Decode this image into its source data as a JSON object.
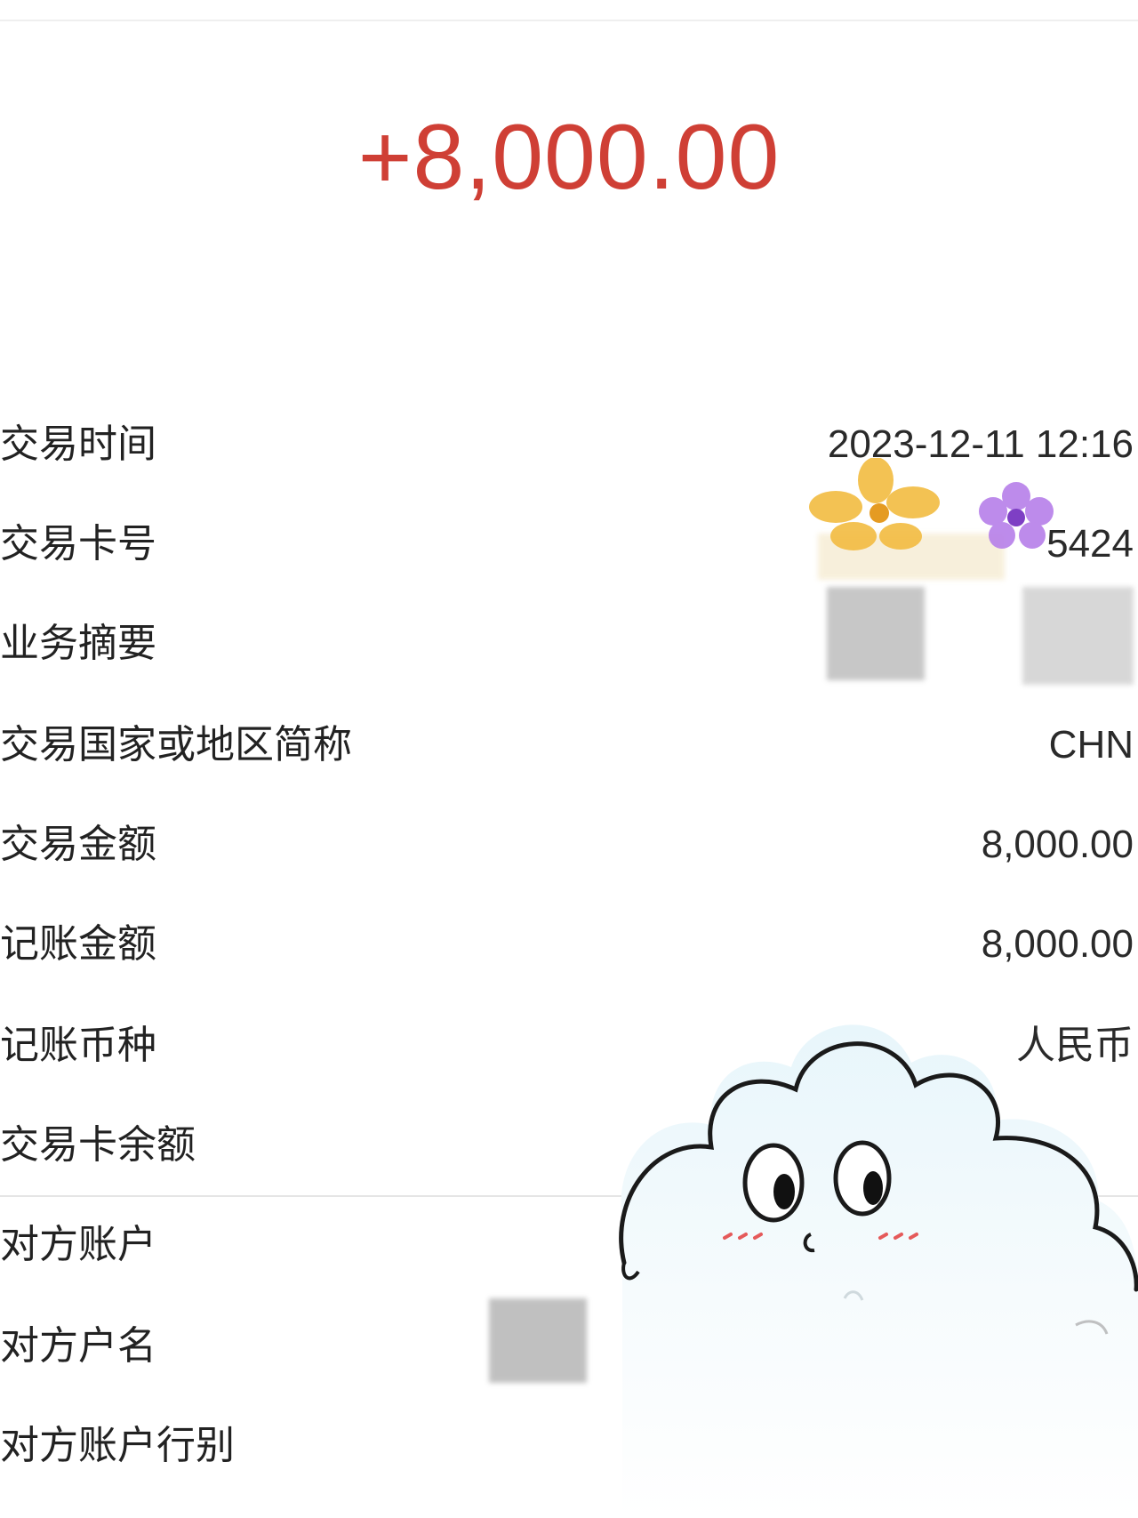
{
  "amount": "+8,000.00",
  "accent_color": "#cf3f35",
  "rows": [
    {
      "label": "交易时间",
      "value": "2023-12-11 12:16"
    },
    {
      "label": "交易卡号",
      "value": "5424"
    },
    {
      "label": "业务摘要",
      "value": ""
    },
    {
      "label": "交易国家或地区简称",
      "value": "CHN"
    },
    {
      "label": "交易金额",
      "value": "8,000.00"
    },
    {
      "label": "记账金额",
      "value": "8,000.00"
    },
    {
      "label": "记账币种",
      "value": "人民币"
    },
    {
      "label": "交易卡余额",
      "value": ""
    },
    {
      "label": "对方账户",
      "value": ""
    },
    {
      "label": "对方户名",
      "value": ""
    },
    {
      "label": "对方账户行别",
      "value": ""
    }
  ],
  "stickers": [
    "yellow-flower-sticker",
    "purple-flower-sticker",
    "cloud-character-sticker"
  ]
}
